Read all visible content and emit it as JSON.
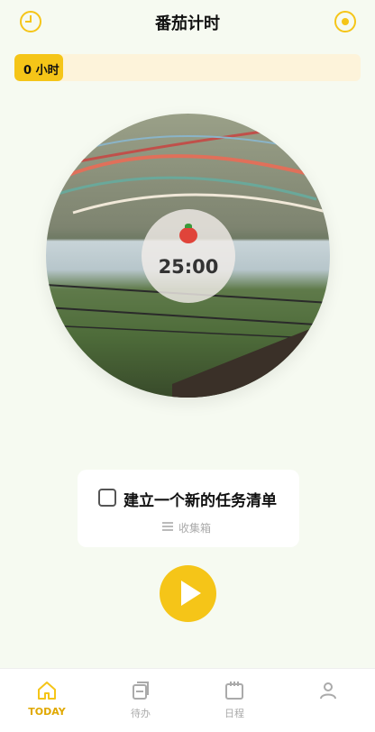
{
  "header": {
    "title": "番茄计时",
    "left_icon": "clock-icon",
    "right_icon": "target-icon"
  },
  "progress": {
    "label": "0 小时"
  },
  "timer": {
    "icon": "tomato-icon",
    "time": "25:00"
  },
  "task": {
    "text": "建立一个新的任务清单",
    "inbox_label": "收集箱"
  },
  "controls": {
    "play_icon": "play-icon"
  },
  "tabs": [
    {
      "label": "TODAY",
      "icon": "home-icon",
      "active": true
    },
    {
      "label": "待办",
      "icon": "todo-icon",
      "active": false
    },
    {
      "label": "日程",
      "icon": "calendar-icon",
      "active": false
    },
    {
      "label": "",
      "icon": "profile-icon",
      "active": false
    }
  ],
  "colors": {
    "accent": "#f5c518",
    "background": "#f6faf1",
    "tomato": "#e0443a"
  }
}
